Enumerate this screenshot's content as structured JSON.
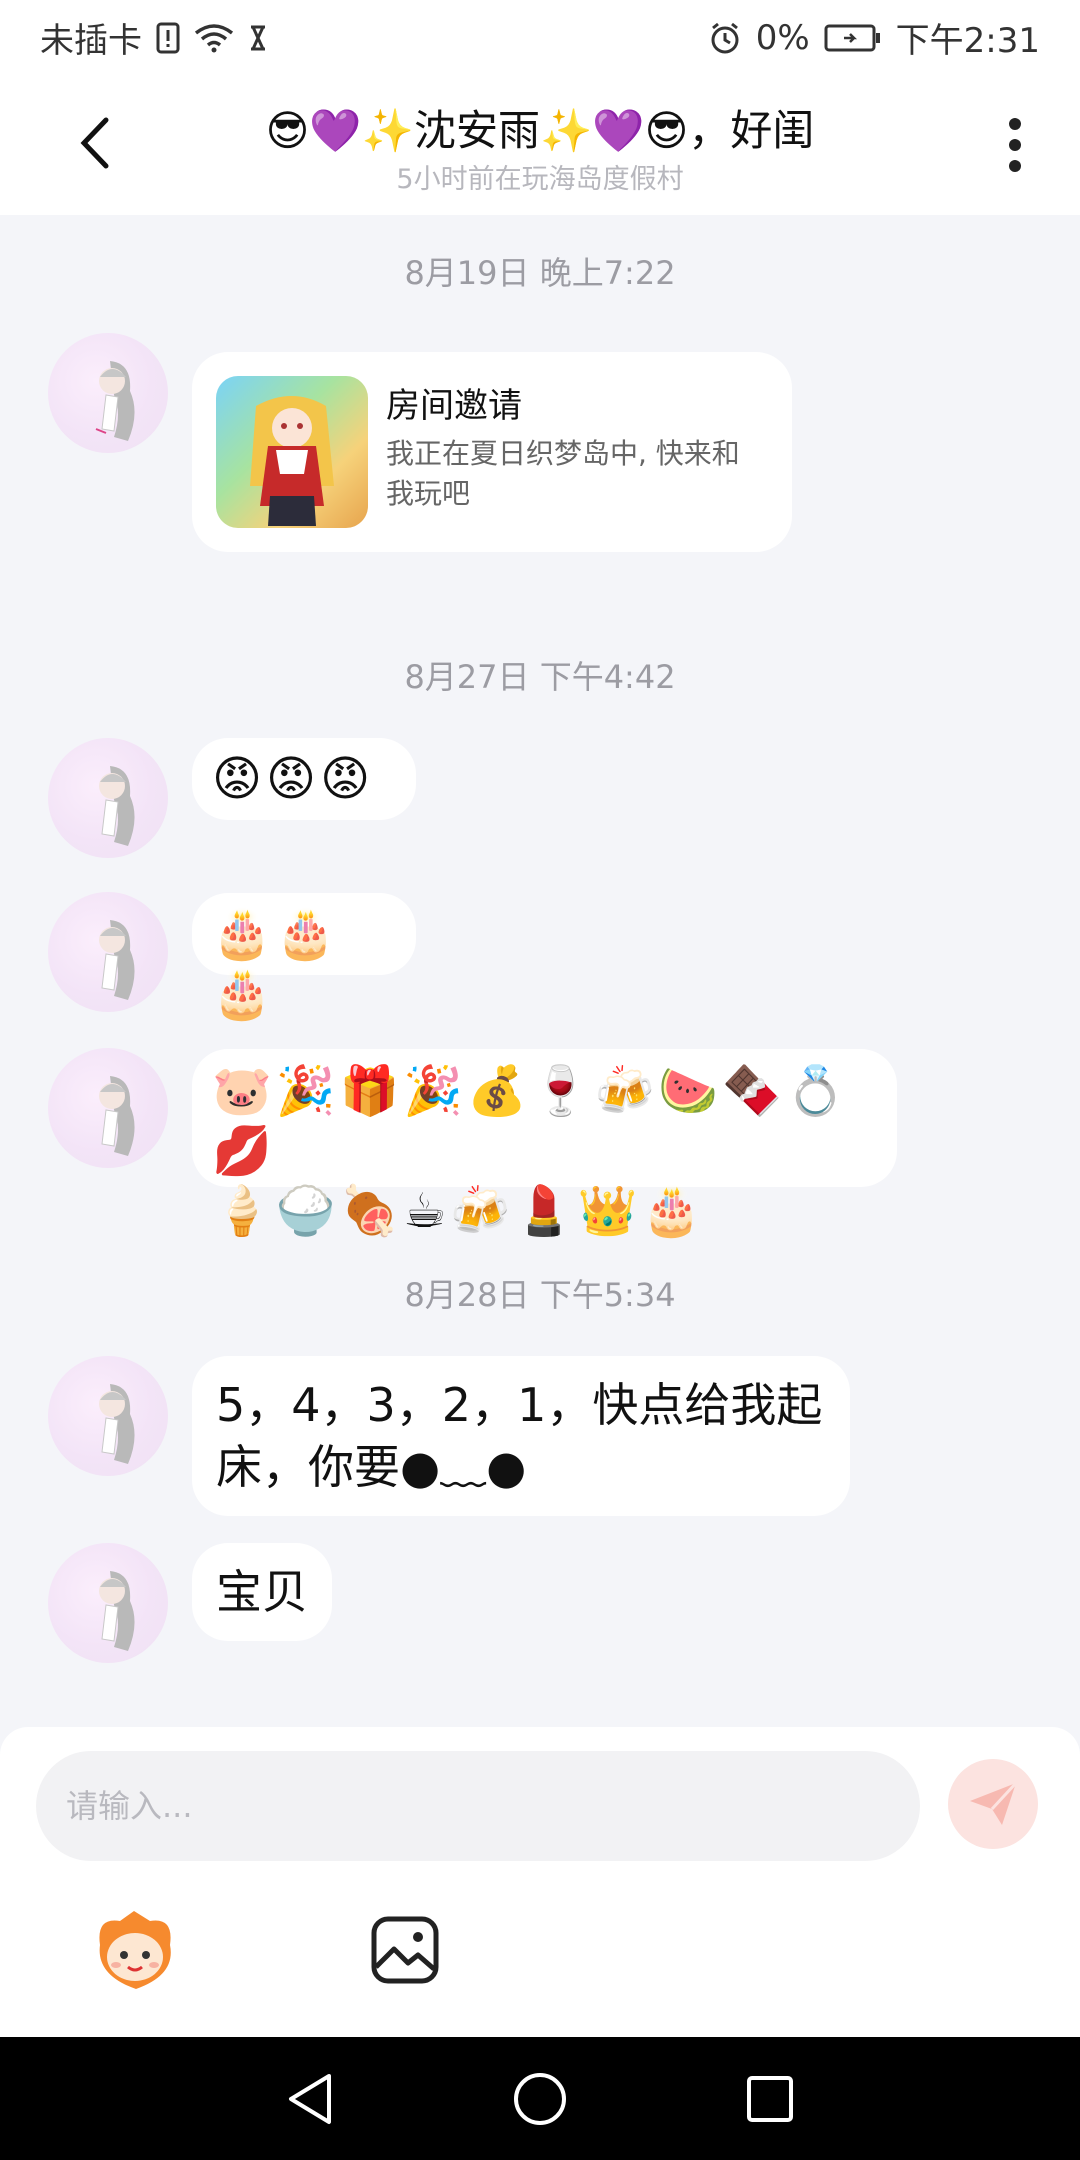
{
  "status_bar": {
    "carrier": "未插卡",
    "battery_percent": "0%",
    "time": "下午2:31"
  },
  "header": {
    "title": "😎💜✨沈安雨✨💜😎，好闺",
    "subtitle": "5小时前在玩海岛度假村"
  },
  "messages": {
    "ts1": "8月19日 晚上7:22",
    "invite": {
      "title": "房间邀请",
      "desc": "我正在夏日织梦岛中, 快来和我玩吧"
    },
    "ts2": "8月27日 下午4:42",
    "angry": "😡😡😡",
    "cakes": "🎂🎂🎂",
    "gifts_line1": "🐷🎉🎁🎉💰🍷🍻🍉🍫💍💋",
    "gifts_line2": "🍦🍚🍖☕🍻💄👑🎂",
    "ts3": "8月28日 下午5:34",
    "countdown": "5，4，3，2，1，快点给我起床，你要●﹏●",
    "baby": "宝贝"
  },
  "composer": {
    "placeholder": "请输入..."
  },
  "icons": {
    "back": "chevron-left-icon",
    "more": "more-vertical-icon",
    "send": "send-icon",
    "emoji_tool": "mascot-emoji-icon",
    "image_tool": "image-icon"
  },
  "colors": {
    "background": "#f4f5f9",
    "bubble": "#ffffff",
    "send_button": "#fce3e0",
    "navbar": "#000000"
  }
}
